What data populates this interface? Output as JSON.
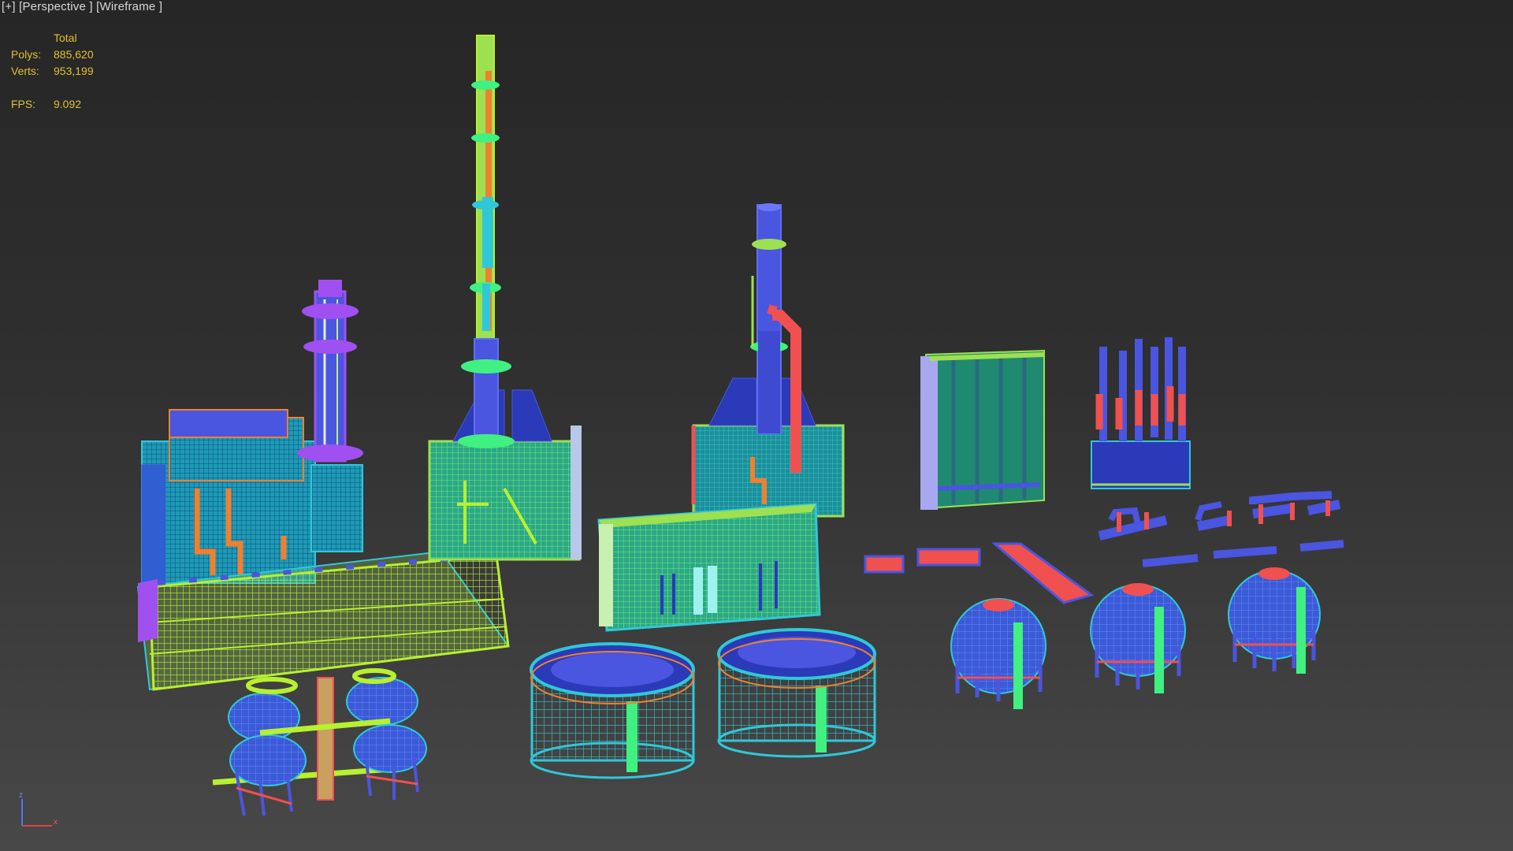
{
  "viewport": {
    "labels": {
      "plus": "[+]",
      "view": "[Perspective ]",
      "shading": "[Wireframe ]"
    },
    "stats": {
      "total_label": "Total",
      "polys_label": "Polys:",
      "polys_value": "885,620",
      "verts_label": "Verts:",
      "verts_value": "953,199",
      "fps_label": "FPS:",
      "fps_value": "9.092"
    },
    "axis_labels": {
      "z": "z",
      "x": "x"
    }
  },
  "colors": {
    "background_top": "#262626",
    "background_bottom": "#484848",
    "stats_text": "#e0c030",
    "label_text": "#d8d8d8",
    "wire_blue": "#4a55e0",
    "wire_cyan": "#30c8d8",
    "wire_teal": "#2aa8a0",
    "wire_green": "#9de050",
    "wire_lime": "#b8f030",
    "wire_orange": "#f08030",
    "wire_red": "#f05050",
    "wire_purple": "#a050f0",
    "wire_bright_green": "#40f080"
  }
}
